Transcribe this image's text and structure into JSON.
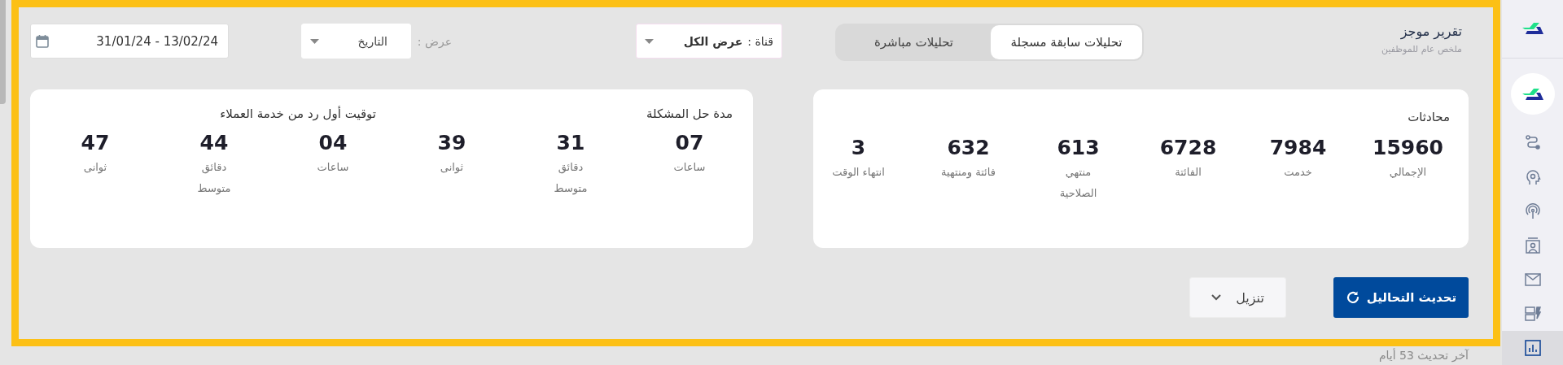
{
  "sidebar": {
    "items": [
      {
        "kind": "route",
        "selected": false
      },
      {
        "kind": "assistant",
        "selected": false
      },
      {
        "kind": "broadcast",
        "selected": false
      },
      {
        "kind": "contact",
        "selected": false
      },
      {
        "kind": "mail",
        "selected": false
      },
      {
        "kind": "server",
        "selected": false
      },
      {
        "kind": "chart",
        "selected": true
      }
    ]
  },
  "header": {
    "title": "تقرير موجز",
    "subtitle": "ملخص عام للموظفين"
  },
  "mode_tabs": [
    {
      "label": "تحليلات سابقة مسجلة",
      "selected": true
    },
    {
      "label": "تحليلات مباشرة",
      "selected": false
    }
  ],
  "channel_filter": {
    "label": "قناة :",
    "value": "عرض الكل"
  },
  "view_filter": {
    "label": "عرض :",
    "value": "التاريخ"
  },
  "date_range": {
    "value": "31/01/24 - 13/02/24"
  },
  "conversations": {
    "title": "محادثات",
    "stats": [
      {
        "value": "15960",
        "label": "الإجمالي"
      },
      {
        "value": "7984",
        "label": "خدمت"
      },
      {
        "value": "6728",
        "label": "الفائتة"
      },
      {
        "value": "613",
        "label": "منتهي\nالصلاحية"
      },
      {
        "value": "632",
        "label": "فائتة ومنتهية"
      },
      {
        "value": "3",
        "label": "انتهاء الوقت"
      }
    ]
  },
  "timing": {
    "groups": [
      {
        "title": "مدة حل المشكلة",
        "stats": [
          {
            "value": "07",
            "label": "ساعات"
          },
          {
            "value": "31",
            "label": "دقائق",
            "note": "متوسط"
          },
          {
            "value": "39",
            "label": "ثوانى"
          }
        ]
      },
      {
        "title": "توقيت أول رد من خدمة العملاء",
        "stats": [
          {
            "value": "04",
            "label": "ساعات"
          },
          {
            "value": "44",
            "label": "دقائق",
            "note": "متوسط"
          },
          {
            "value": "47",
            "label": "ثوانى"
          }
        ]
      }
    ]
  },
  "actions": {
    "refresh": "تحديث التحاليل",
    "download": "تنزيل"
  },
  "last_update": "آخر تحديث 53 أيام"
}
